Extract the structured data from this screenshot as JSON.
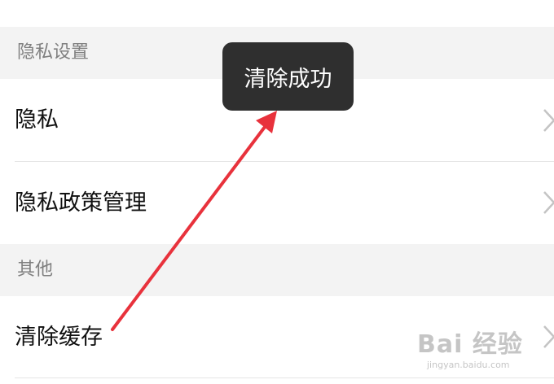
{
  "toast": {
    "text": "清除成功"
  },
  "sections": [
    {
      "header": "隐私设置",
      "items": [
        "隐私",
        "隐私政策管理"
      ]
    },
    {
      "header": "其他",
      "items": [
        "清除缓存"
      ]
    }
  ],
  "watermark": {
    "logo": "Bai 经验",
    "site": "jingyan.baidu.com"
  },
  "colors": {
    "section_bg": "#f3f3f3",
    "header_text": "#7f7f7f",
    "toast_bg": "#2f2f2f",
    "annotation_arrow": "#e8323c",
    "chevron": "#c4c4c4"
  },
  "icons": [
    "chevron-right-icon",
    "annotation-arrow"
  ]
}
